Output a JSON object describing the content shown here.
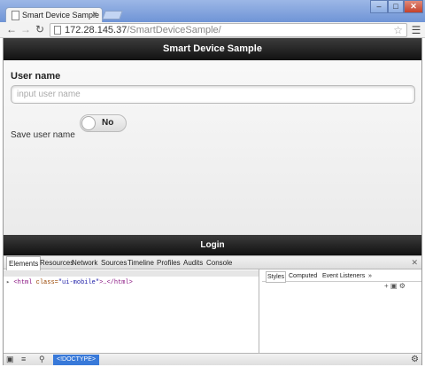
{
  "browser": {
    "tab_title": "Smart Device Sample",
    "tab_close": "×",
    "url_host": "172.28.145.37",
    "url_path": "/SmartDeviceSample/",
    "window_buttons": [
      "‒",
      "□",
      "✕"
    ]
  },
  "page": {
    "header_title": "Smart Device Sample",
    "username_label": "User name",
    "username_placeholder": "input user name",
    "username_value": "",
    "save_label": "Save user name",
    "toggle_label": "No",
    "login_label": "Login"
  },
  "devtools": {
    "tabs": [
      "Elements",
      "Resources",
      "Network",
      "Sources",
      "Timeline",
      "Profiles",
      "Audits",
      "Console"
    ],
    "active_tab": "Elements",
    "dom_tag_open": "<html",
    "dom_attr_name": "class=",
    "dom_attr_value": "\"ui-mobile\"",
    "dom_tag_close": ">…</html>",
    "styles_tabs": [
      "Styles",
      "Computed",
      "Event Listeners"
    ],
    "styles_more": "»",
    "breadcrumb": "<!DOCTYPE>"
  }
}
